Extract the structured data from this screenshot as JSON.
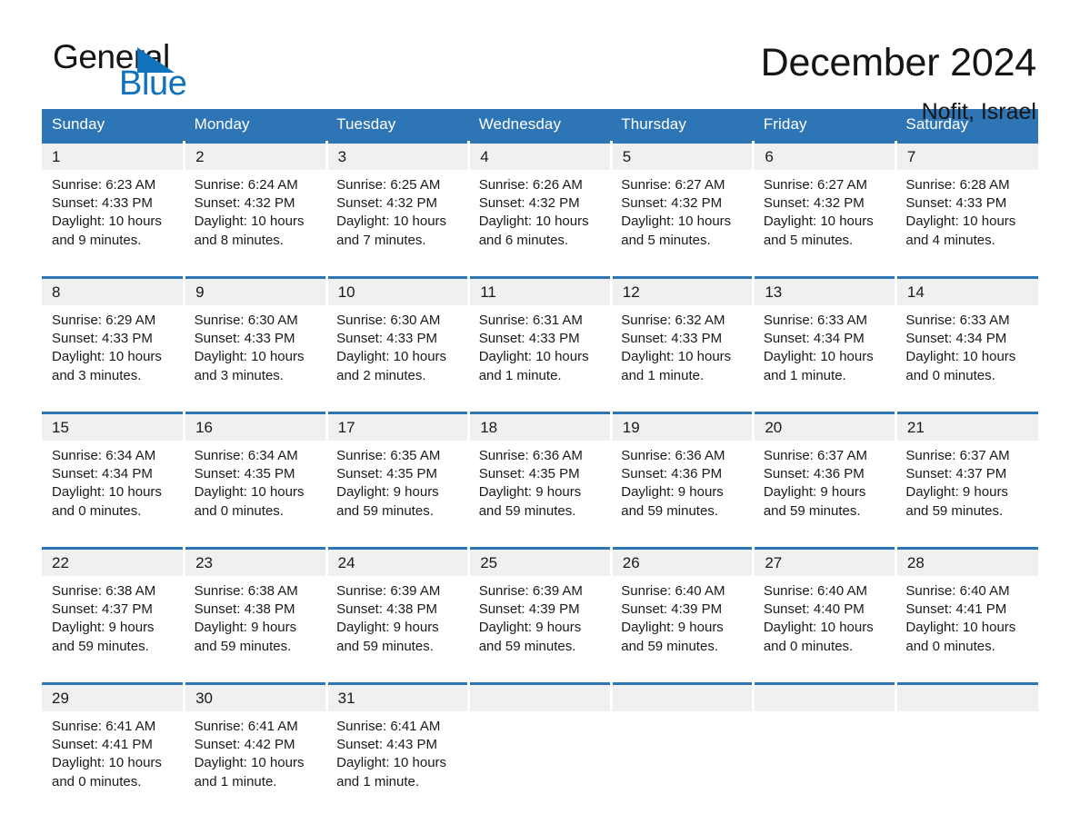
{
  "brand": {
    "word_one": "General",
    "word_two": "Blue"
  },
  "header": {
    "title": "December 2024",
    "subtitle": "Nofit, Israel"
  },
  "colors": {
    "header_blue": "#2e75b6",
    "logo_blue": "#1273bd",
    "daynum_band": "#f0f0f0",
    "text": "#1a1a1a"
  },
  "weekdays": [
    "Sunday",
    "Monday",
    "Tuesday",
    "Wednesday",
    "Thursday",
    "Friday",
    "Saturday"
  ],
  "weeks": [
    {
      "days": [
        {
          "num": "1",
          "sunrise": "Sunrise: 6:23 AM",
          "sunset": "Sunset: 4:33 PM",
          "daylight1": "Daylight: 10 hours",
          "daylight2": "and 9 minutes."
        },
        {
          "num": "2",
          "sunrise": "Sunrise: 6:24 AM",
          "sunset": "Sunset: 4:32 PM",
          "daylight1": "Daylight: 10 hours",
          "daylight2": "and 8 minutes."
        },
        {
          "num": "3",
          "sunrise": "Sunrise: 6:25 AM",
          "sunset": "Sunset: 4:32 PM",
          "daylight1": "Daylight: 10 hours",
          "daylight2": "and 7 minutes."
        },
        {
          "num": "4",
          "sunrise": "Sunrise: 6:26 AM",
          "sunset": "Sunset: 4:32 PM",
          "daylight1": "Daylight: 10 hours",
          "daylight2": "and 6 minutes."
        },
        {
          "num": "5",
          "sunrise": "Sunrise: 6:27 AM",
          "sunset": "Sunset: 4:32 PM",
          "daylight1": "Daylight: 10 hours",
          "daylight2": "and 5 minutes."
        },
        {
          "num": "6",
          "sunrise": "Sunrise: 6:27 AM",
          "sunset": "Sunset: 4:32 PM",
          "daylight1": "Daylight: 10 hours",
          "daylight2": "and 5 minutes."
        },
        {
          "num": "7",
          "sunrise": "Sunrise: 6:28 AM",
          "sunset": "Sunset: 4:33 PM",
          "daylight1": "Daylight: 10 hours",
          "daylight2": "and 4 minutes."
        }
      ]
    },
    {
      "days": [
        {
          "num": "8",
          "sunrise": "Sunrise: 6:29 AM",
          "sunset": "Sunset: 4:33 PM",
          "daylight1": "Daylight: 10 hours",
          "daylight2": "and 3 minutes."
        },
        {
          "num": "9",
          "sunrise": "Sunrise: 6:30 AM",
          "sunset": "Sunset: 4:33 PM",
          "daylight1": "Daylight: 10 hours",
          "daylight2": "and 3 minutes."
        },
        {
          "num": "10",
          "sunrise": "Sunrise: 6:30 AM",
          "sunset": "Sunset: 4:33 PM",
          "daylight1": "Daylight: 10 hours",
          "daylight2": "and 2 minutes."
        },
        {
          "num": "11",
          "sunrise": "Sunrise: 6:31 AM",
          "sunset": "Sunset: 4:33 PM",
          "daylight1": "Daylight: 10 hours",
          "daylight2": "and 1 minute."
        },
        {
          "num": "12",
          "sunrise": "Sunrise: 6:32 AM",
          "sunset": "Sunset: 4:33 PM",
          "daylight1": "Daylight: 10 hours",
          "daylight2": "and 1 minute."
        },
        {
          "num": "13",
          "sunrise": "Sunrise: 6:33 AM",
          "sunset": "Sunset: 4:34 PM",
          "daylight1": "Daylight: 10 hours",
          "daylight2": "and 1 minute."
        },
        {
          "num": "14",
          "sunrise": "Sunrise: 6:33 AM",
          "sunset": "Sunset: 4:34 PM",
          "daylight1": "Daylight: 10 hours",
          "daylight2": "and 0 minutes."
        }
      ]
    },
    {
      "days": [
        {
          "num": "15",
          "sunrise": "Sunrise: 6:34 AM",
          "sunset": "Sunset: 4:34 PM",
          "daylight1": "Daylight: 10 hours",
          "daylight2": "and 0 minutes."
        },
        {
          "num": "16",
          "sunrise": "Sunrise: 6:34 AM",
          "sunset": "Sunset: 4:35 PM",
          "daylight1": "Daylight: 10 hours",
          "daylight2": "and 0 minutes."
        },
        {
          "num": "17",
          "sunrise": "Sunrise: 6:35 AM",
          "sunset": "Sunset: 4:35 PM",
          "daylight1": "Daylight: 9 hours",
          "daylight2": "and 59 minutes."
        },
        {
          "num": "18",
          "sunrise": "Sunrise: 6:36 AM",
          "sunset": "Sunset: 4:35 PM",
          "daylight1": "Daylight: 9 hours",
          "daylight2": "and 59 minutes."
        },
        {
          "num": "19",
          "sunrise": "Sunrise: 6:36 AM",
          "sunset": "Sunset: 4:36 PM",
          "daylight1": "Daylight: 9 hours",
          "daylight2": "and 59 minutes."
        },
        {
          "num": "20",
          "sunrise": "Sunrise: 6:37 AM",
          "sunset": "Sunset: 4:36 PM",
          "daylight1": "Daylight: 9 hours",
          "daylight2": "and 59 minutes."
        },
        {
          "num": "21",
          "sunrise": "Sunrise: 6:37 AM",
          "sunset": "Sunset: 4:37 PM",
          "daylight1": "Daylight: 9 hours",
          "daylight2": "and 59 minutes."
        }
      ]
    },
    {
      "days": [
        {
          "num": "22",
          "sunrise": "Sunrise: 6:38 AM",
          "sunset": "Sunset: 4:37 PM",
          "daylight1": "Daylight: 9 hours",
          "daylight2": "and 59 minutes."
        },
        {
          "num": "23",
          "sunrise": "Sunrise: 6:38 AM",
          "sunset": "Sunset: 4:38 PM",
          "daylight1": "Daylight: 9 hours",
          "daylight2": "and 59 minutes."
        },
        {
          "num": "24",
          "sunrise": "Sunrise: 6:39 AM",
          "sunset": "Sunset: 4:38 PM",
          "daylight1": "Daylight: 9 hours",
          "daylight2": "and 59 minutes."
        },
        {
          "num": "25",
          "sunrise": "Sunrise: 6:39 AM",
          "sunset": "Sunset: 4:39 PM",
          "daylight1": "Daylight: 9 hours",
          "daylight2": "and 59 minutes."
        },
        {
          "num": "26",
          "sunrise": "Sunrise: 6:40 AM",
          "sunset": "Sunset: 4:39 PM",
          "daylight1": "Daylight: 9 hours",
          "daylight2": "and 59 minutes."
        },
        {
          "num": "27",
          "sunrise": "Sunrise: 6:40 AM",
          "sunset": "Sunset: 4:40 PM",
          "daylight1": "Daylight: 10 hours",
          "daylight2": "and 0 minutes."
        },
        {
          "num": "28",
          "sunrise": "Sunrise: 6:40 AM",
          "sunset": "Sunset: 4:41 PM",
          "daylight1": "Daylight: 10 hours",
          "daylight2": "and 0 minutes."
        }
      ]
    },
    {
      "days": [
        {
          "num": "29",
          "sunrise": "Sunrise: 6:41 AM",
          "sunset": "Sunset: 4:41 PM",
          "daylight1": "Daylight: 10 hours",
          "daylight2": "and 0 minutes."
        },
        {
          "num": "30",
          "sunrise": "Sunrise: 6:41 AM",
          "sunset": "Sunset: 4:42 PM",
          "daylight1": "Daylight: 10 hours",
          "daylight2": "and 1 minute."
        },
        {
          "num": "31",
          "sunrise": "Sunrise: 6:41 AM",
          "sunset": "Sunset: 4:43 PM",
          "daylight1": "Daylight: 10 hours",
          "daylight2": "and 1 minute."
        },
        {
          "num": "",
          "sunrise": "",
          "sunset": "",
          "daylight1": "",
          "daylight2": ""
        },
        {
          "num": "",
          "sunrise": "",
          "sunset": "",
          "daylight1": "",
          "daylight2": ""
        },
        {
          "num": "",
          "sunrise": "",
          "sunset": "",
          "daylight1": "",
          "daylight2": ""
        },
        {
          "num": "",
          "sunrise": "",
          "sunset": "",
          "daylight1": "",
          "daylight2": ""
        }
      ]
    }
  ]
}
